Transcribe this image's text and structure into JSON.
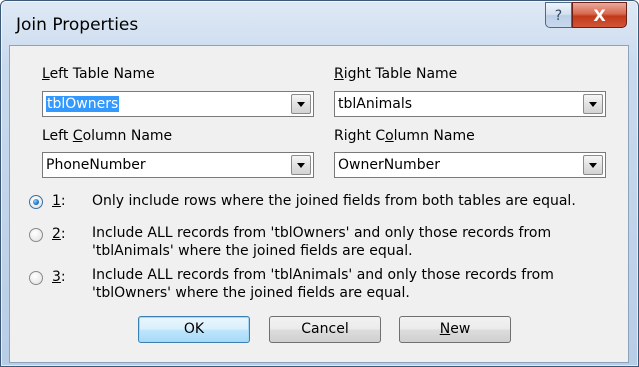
{
  "window": {
    "title": "Join Properties"
  },
  "titlebar": {
    "help_glyph": "?",
    "close_glyph": "X"
  },
  "left_table": {
    "label_key": "L",
    "label_rest": "eft Table Name",
    "value": "tblOwners"
  },
  "right_table": {
    "label_key": "R",
    "label_rest": "ight Table Name",
    "value": "tblAnimals"
  },
  "left_column": {
    "label_pre": "Left ",
    "label_key": "C",
    "label_rest": "olumn Name",
    "value": "PhoneNumber"
  },
  "right_column": {
    "label_pre": "Right C",
    "label_key": "o",
    "label_rest": "lumn Name",
    "value": "OwnerNumber"
  },
  "options": [
    {
      "num_key": "1",
      "num_rest": ":",
      "line1": "Only include rows where the joined fields from both tables are equal.",
      "line2": "",
      "checked": true
    },
    {
      "num_key": "2",
      "num_rest": ":",
      "line1": "Include ALL records from 'tblOwners' and only those records from",
      "line2": "'tblAnimals' where the joined fields are equal.",
      "checked": false
    },
    {
      "num_key": "3",
      "num_rest": ":",
      "line1": "Include ALL records from 'tblAnimals' and only those records from",
      "line2": "'tblOwners' where the joined fields are equal.",
      "checked": false
    }
  ],
  "buttons": {
    "ok": "OK",
    "cancel": "Cancel",
    "new_key": "N",
    "new_rest": "ew"
  },
  "icons": {
    "help": "help-icon",
    "close": "close-icon",
    "dropdown": "chevron-down-icon"
  }
}
